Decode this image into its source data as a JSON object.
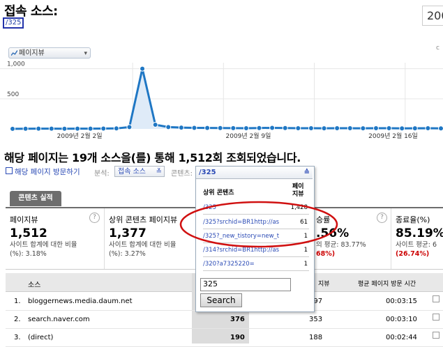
{
  "header": {
    "title": "접속 소스:",
    "page_tag": "/325",
    "date_partial": "200"
  },
  "graph_tab": {
    "label": "페이지뷰",
    "right_label": "c"
  },
  "chart_data": {
    "type": "line",
    "ylabels": [
      "1,000",
      "500"
    ],
    "ymax": 1100,
    "xlabels": [
      "2009년 2월 2일",
      "2009년 2월 9일",
      "2009년 2월 16일"
    ],
    "values": [
      2,
      3,
      4,
      4,
      3,
      4,
      5,
      6,
      8,
      30,
      1000,
      70,
      30,
      22,
      18,
      16,
      14,
      13,
      12,
      15,
      18,
      14,
      12,
      11,
      10,
      12,
      11,
      10,
      12,
      11,
      9,
      10,
      12,
      8
    ],
    "color": "#1f77c4"
  },
  "headline": "해당 페이지는 19개 소스을(를) 통해 1,512회 조회되었습니다.",
  "controls": {
    "visit_link": "해당 페이지 방문하기",
    "analysis_label": "분석:",
    "analysis_value": "접속 소스",
    "content_label": "콘텐츠:",
    "content_value": "/325"
  },
  "content_tab": "콘텐츠 실적",
  "metrics": [
    {
      "label": "페이지뷰",
      "value": "1,512",
      "sub1": "사이트 합계에 대한 비율",
      "sub2": "(%): 3.18%"
    },
    {
      "label": "상위 콘텐츠 페이지뷰",
      "value": "1,377",
      "sub1": "사이트 합계에 대한 비율",
      "sub2": "(%): 3.27%"
    },
    {
      "label": "",
      "value": "",
      "sub1": "",
      "sub2": ""
    },
    {
      "label": "승률",
      "value": ".56%",
      "sub1": "의 평균: 83.77%",
      "sub2": "68%)"
    },
    {
      "label": "종료율(%)",
      "value": "85.19%",
      "sub1": "사이트 평균: 6",
      "sub2": "(26.74%)"
    }
  ],
  "table": {
    "headers": {
      "source": "소스",
      "views": "지뷰",
      "avg_time": "평균 페이지 방문 시간"
    },
    "rows": [
      {
        "n": "1.",
        "source": "bloggernews.media.daum.net",
        "col1": "",
        "col2": "697",
        "time": "00:03:15"
      },
      {
        "n": "2.",
        "source": "search.naver.com",
        "col1": "376",
        "col2": "353",
        "time": "00:03:10"
      },
      {
        "n": "3.",
        "source": "(direct)",
        "col1": "190",
        "col2": "188",
        "time": "00:02:44"
      }
    ]
  },
  "popup": {
    "header": "/325",
    "col_content": "상위 콘텐츠",
    "col_views": "페이\n지뷰",
    "items": [
      {
        "label": "/325",
        "count": "1,428"
      },
      {
        "label": "/325?srchid=BR1http://as",
        "count": "61"
      },
      {
        "label": "/325?_new_tistory=new_t",
        "count": "1"
      },
      {
        "label": "/314?srchid=BR1http://as",
        "count": "1"
      },
      {
        "label": "/320?a7325220=",
        "count": "1"
      }
    ],
    "search_value": "325",
    "search_button": "Search"
  }
}
